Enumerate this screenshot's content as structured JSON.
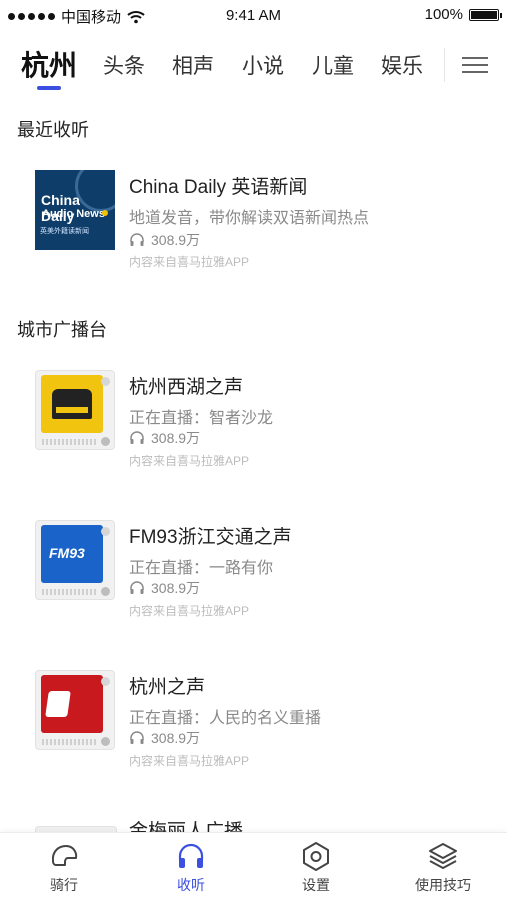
{
  "status_bar": {
    "carrier": "中国移动",
    "time": "9:41 AM",
    "battery": "100%"
  },
  "tabs": [
    {
      "label": "杭州",
      "active": true
    },
    {
      "label": "头条"
    },
    {
      "label": "相声"
    },
    {
      "label": "小说"
    },
    {
      "label": "儿童"
    },
    {
      "label": "娱乐"
    }
  ],
  "recent": {
    "title": "最近收听",
    "items": [
      {
        "thumb_text": [
          "China Daily",
          "Audio News",
          "英美外籍读新闻"
        ],
        "title": "China Daily 英语新闻",
        "subtitle": "地道发音，带你解读双语新闻热点",
        "count": "308.9万",
        "source": "内容来自喜马拉雅APP"
      }
    ]
  },
  "city": {
    "title": "城市广播台",
    "items": [
      {
        "title": "杭州西湖之声",
        "subtitle": "正在直播：智者沙龙",
        "count": "308.9万",
        "source": "内容来自喜马拉雅APP"
      },
      {
        "title": "FM93浙江交通之声",
        "subtitle": "正在直播：一路有你",
        "count": "308.9万",
        "source": "内容来自喜马拉雅APP",
        "thumb_text": "FM93"
      },
      {
        "title": "杭州之声",
        "subtitle": "正在直播：人民的名义重播",
        "count": "308.9万",
        "source": "内容来自喜马拉雅APP"
      }
    ],
    "partial_title": "金梅丽人广播"
  },
  "bottom_nav": [
    {
      "label": "骑行",
      "icon": "helmet-icon"
    },
    {
      "label": "收听",
      "icon": "headphones-icon",
      "active": true
    },
    {
      "label": "设置",
      "icon": "settings-hex-icon"
    },
    {
      "label": "使用技巧",
      "icon": "layers-icon"
    }
  ],
  "colors": {
    "accent": "#3b4fe0"
  }
}
